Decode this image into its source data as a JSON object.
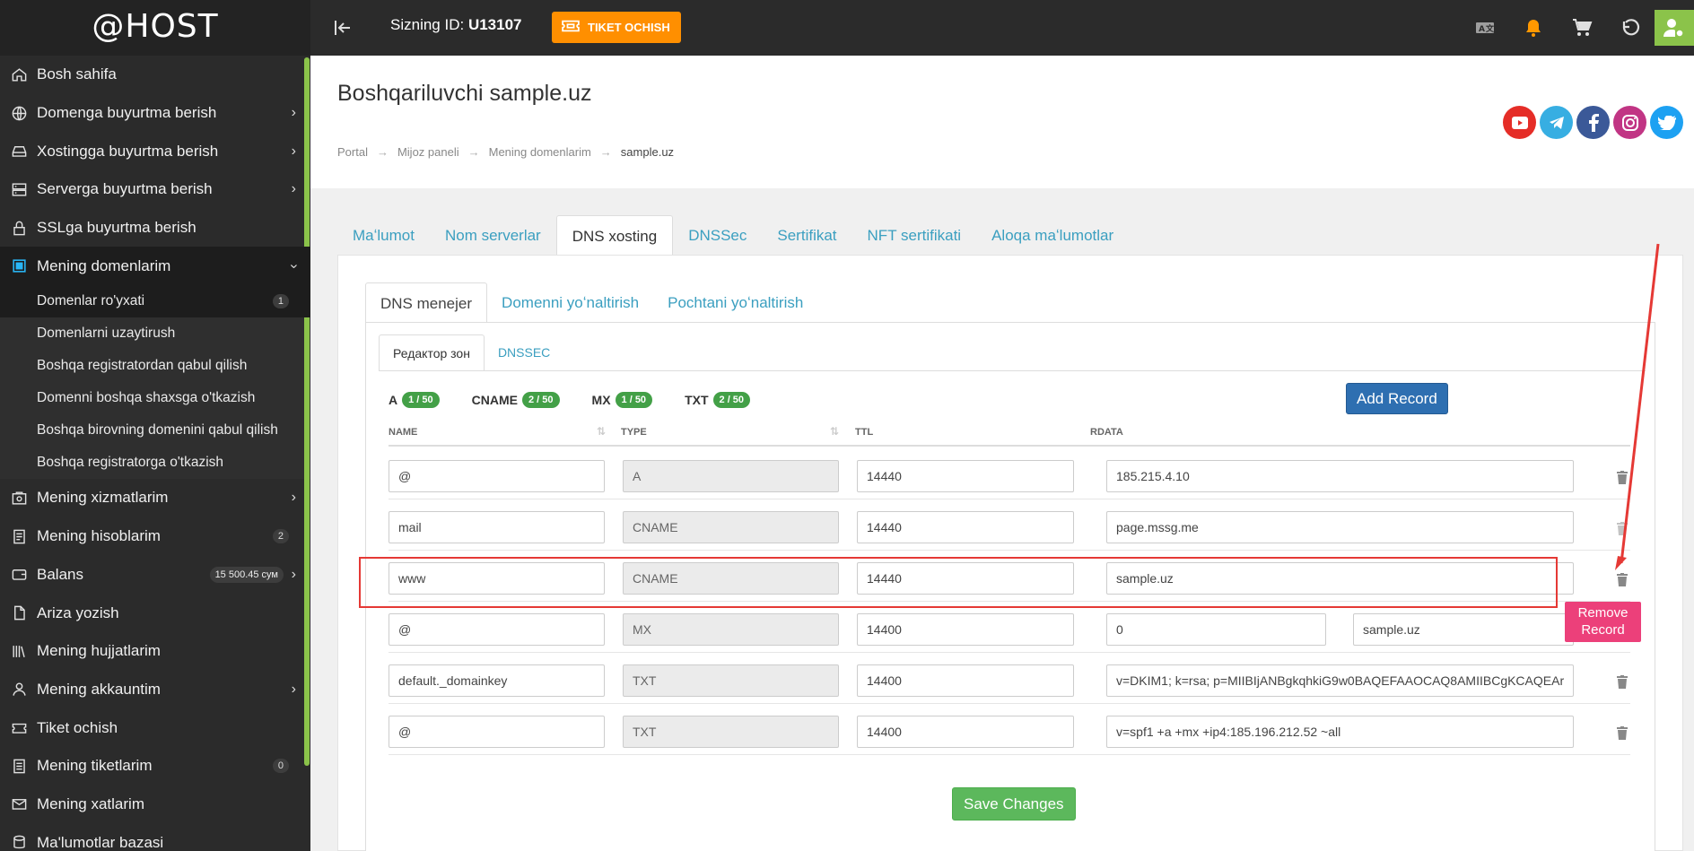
{
  "brand": "@HOST",
  "topbar": {
    "client_id_label": "Sizning ID:",
    "client_id": "U13107",
    "ticket_button": "TIKET OCHISH",
    "icons": [
      "translate-icon",
      "bell-icon",
      "cart-icon",
      "undo-icon",
      "user-settings-icon"
    ]
  },
  "sidebar": {
    "items": [
      {
        "label": "Bosh sahifa",
        "icon": "home-icon"
      },
      {
        "label": "Domenga buyurtma berish",
        "icon": "globe-icon",
        "chevron": "›"
      },
      {
        "label": "Xostingga buyurtma berish",
        "icon": "hdd-icon",
        "chevron": "›"
      },
      {
        "label": "Serverga buyurtma berish",
        "icon": "server-icon",
        "chevron": "›"
      },
      {
        "label": "SSLga buyurtma berish",
        "icon": "lock-icon"
      },
      {
        "label": "Mening domenlarim",
        "icon": "domain-icon",
        "chevron": "‹"
      }
    ],
    "submenu": [
      {
        "label": "Domenlar ro'yxati",
        "badge": "1"
      },
      {
        "label": "Domenlarni uzaytirush"
      },
      {
        "label": "Boshqa registratordan qabul qilish"
      },
      {
        "label": "Domenni boshqa shaxsga o'tkazish"
      },
      {
        "label": "Boshqa birovning domenini qabul qilish"
      },
      {
        "label": "Boshqa registratorga o'tkazish"
      }
    ],
    "items2": [
      {
        "label": "Mening xizmatlarim",
        "icon": "services-icon",
        "chevron": "›"
      },
      {
        "label": "Mening hisoblarim",
        "icon": "invoice-icon",
        "badge": "2"
      },
      {
        "label": "Balans",
        "icon": "wallet-icon",
        "badge": "15 500.45 сум",
        "chevron": "›"
      },
      {
        "label": "Ariza yozish",
        "icon": "document-icon"
      },
      {
        "label": "Mening hujjatlarim",
        "icon": "library-icon"
      },
      {
        "label": "Mening akkauntim",
        "icon": "user-icon",
        "chevron": "›"
      },
      {
        "label": "Tiket ochish",
        "icon": "ticket-icon"
      },
      {
        "label": "Mening tiketlarim",
        "icon": "list-icon",
        "badge": "0"
      },
      {
        "label": "Mening xatlarim",
        "icon": "mail-icon"
      },
      {
        "label": "Ma'lumotlar bazasi",
        "icon": "database-icon"
      }
    ]
  },
  "page": {
    "title": "Boshqariluvchi sample.uz",
    "breadcrumb": [
      "Portal",
      "Mijoz paneli",
      "Mening domenlarim",
      "sample.uz"
    ],
    "socials": [
      {
        "name": "youtube-icon",
        "color": "#e52d27",
        "glyph": "▶"
      },
      {
        "name": "telegram-icon",
        "color": "#37aee2",
        "glyph": "➤"
      },
      {
        "name": "facebook-icon",
        "color": "#3b5998",
        "glyph": "f"
      },
      {
        "name": "instagram-icon",
        "color": "#c13584",
        "glyph": "◎"
      },
      {
        "name": "twitter-icon",
        "color": "#1da1f2",
        "glyph": "t"
      }
    ]
  },
  "tabs": [
    "Maʻlumot",
    "Nom serverlar",
    "DNS xosting",
    "DNSSec",
    "Sertifikat",
    "NFT sertifikati",
    "Aloqa maʻlumotlar"
  ],
  "tabs2": [
    "DNS menejer",
    "Domenni yoʻnaltirish",
    "Pochtani yoʻnaltirish"
  ],
  "tabs3": [
    "Редактор зон",
    "DNSSEC"
  ],
  "counters": [
    {
      "type": "A",
      "count": "1 / 50"
    },
    {
      "type": "CNAME",
      "count": "2 / 50"
    },
    {
      "type": "MX",
      "count": "1 / 50"
    },
    {
      "type": "TXT",
      "count": "2 / 50"
    }
  ],
  "add_record": "Add Record",
  "table": {
    "headers": [
      "NAME",
      "TYPE",
      "TTL",
      "RDATA"
    ],
    "rows": [
      {
        "name": "@",
        "type": "A",
        "ttl": "14440",
        "rdata": "185.215.4.10"
      },
      {
        "name": "mail",
        "type": "CNAME",
        "ttl": "14440",
        "rdata": "page.mssg.me"
      },
      {
        "name": "www",
        "type": "CNAME",
        "ttl": "14440",
        "rdata": "sample.uz"
      },
      {
        "name": "@",
        "type": "MX",
        "ttl": "14400",
        "priority": "0",
        "rdata": "sample.uz"
      },
      {
        "name": "default._domainkey",
        "type": "TXT",
        "ttl": "14400",
        "rdata": "v=DKIM1; k=rsa; p=MIIBIjANBgkqhkiG9w0BAQEFAAOCAQ8AMIIBCgKCAQEAr"
      },
      {
        "name": "@",
        "type": "TXT",
        "ttl": "14400",
        "rdata": "v=spf1 +a +mx +ip4:185.196.212.52 ~all"
      }
    ]
  },
  "save_changes": "Save Changes",
  "tooltip": "Remove Record",
  "colors": {
    "accent": "#8bc34a",
    "ticket": "#ff8f00",
    "add": "#2e6fb1",
    "save": "#5cb85c",
    "annotation": "#e53935",
    "tooltip": "#ec407a"
  }
}
